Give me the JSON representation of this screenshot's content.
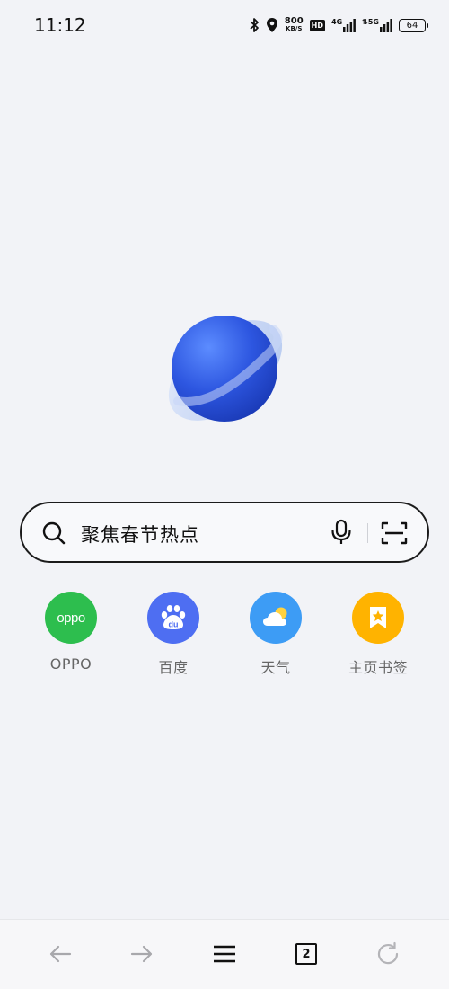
{
  "status_bar": {
    "time": "11:12",
    "net_speed_value": "800",
    "net_speed_unit": "KB/S",
    "hd_label": "HD",
    "signal1_label": "4G",
    "signal2_label": "5G",
    "battery_level": "64"
  },
  "search": {
    "text": "聚焦春节热点"
  },
  "shortcuts": [
    {
      "label": "OPPO",
      "icon_text": "oppo",
      "color": "#2dbe4e",
      "icon": "oppo-logo-icon"
    },
    {
      "label": "百度",
      "icon_text": "du",
      "color": "#4e6ef2",
      "icon": "baidu-paw-icon"
    },
    {
      "label": "天气",
      "color": "#3d9cf5",
      "icon": "weather-icon"
    },
    {
      "label": "主页书签",
      "color": "#ffb300",
      "icon": "bookmark-star-icon"
    }
  ],
  "bottom_nav": {
    "tab_count": "2"
  },
  "colors": {
    "background": "#f2f3f7",
    "planet_blue": "#2d56e0"
  }
}
